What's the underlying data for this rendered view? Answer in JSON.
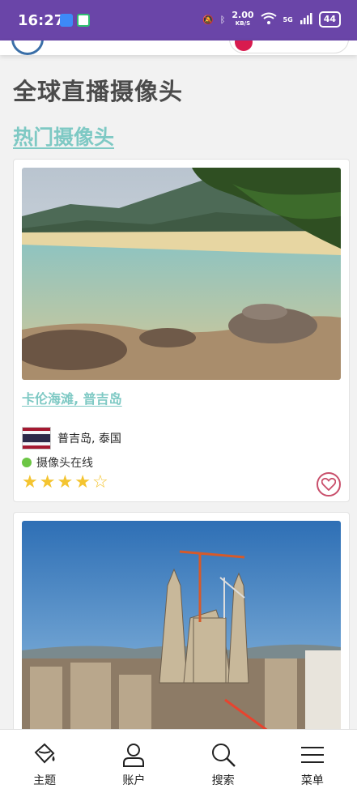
{
  "status_bar": {
    "time": "16:27",
    "net_speed": "2.00",
    "net_unit": "KB/S",
    "signal": "5G",
    "battery": "44"
  },
  "page": {
    "title": "全球直播摄像头",
    "section_title": "热门摄像头"
  },
  "cards": [
    {
      "title": "卡伦海滩, 普吉岛",
      "location": "普吉岛, 泰国",
      "status": "摄像头在线",
      "rating": 4,
      "rating_max": 5,
      "status_color": "#6cc644"
    }
  ],
  "bottom_nav": {
    "items": [
      {
        "label": "主题",
        "icon": "paint-bucket-icon"
      },
      {
        "label": "账户",
        "icon": "user-icon"
      },
      {
        "label": "搜索",
        "icon": "search-icon"
      },
      {
        "label": "菜单",
        "icon": "menu-icon"
      }
    ]
  },
  "colors": {
    "status_bar": "#6a45a8",
    "accent_link": "#7ec9c4",
    "favorite": "#c94f6b",
    "arrow": "#e8432e"
  }
}
